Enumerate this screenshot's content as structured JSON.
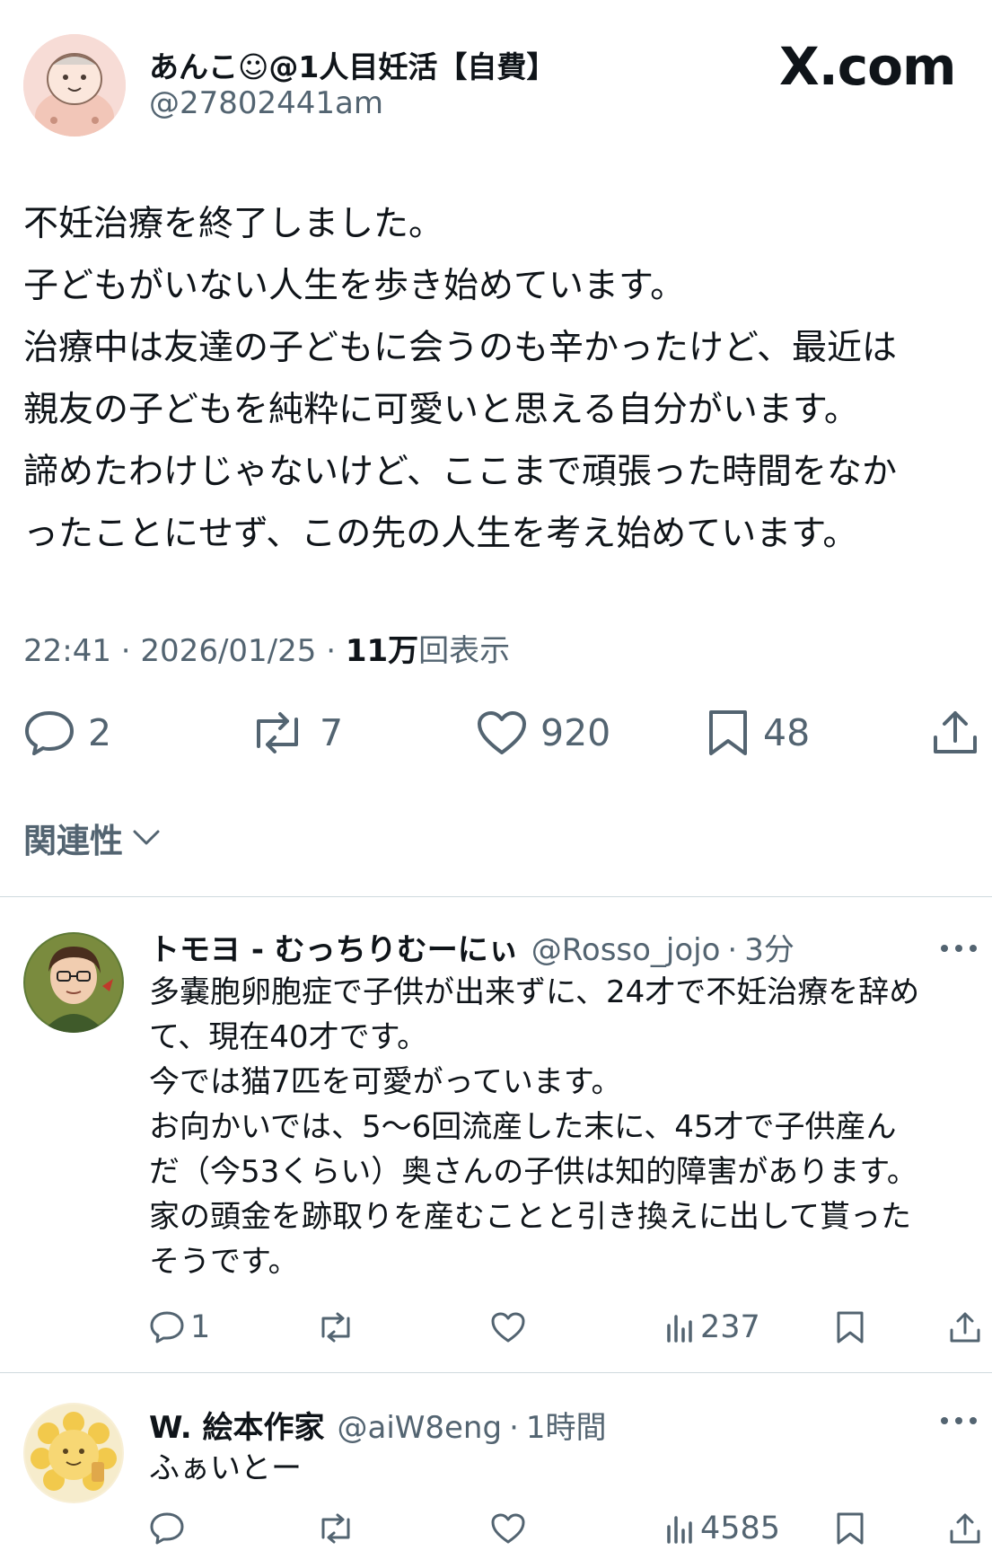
{
  "main_tweet": {
    "display_name": "あんこ☺@1人目妊活【自費】",
    "handle": "@27802441am",
    "site_logo": "X.com",
    "body_lines": [
      "不妊治療を終了しました。",
      "子どもがいない人生を歩き始めています。",
      "治療中は友達の子どもに会うのも辛かったけど、最近は",
      "親友の子どもを純粋に可愛いと思える自分がいます。",
      "諦めたわけじゃないけど、ここまで頑張った時間をなか",
      "ったことにせず、この先の人生を考え始めています。"
    ],
    "time": "22:41",
    "date": "2026/01/25",
    "views_count": "11万",
    "views_label": "回表示",
    "sep": "·",
    "actions": {
      "replies": "2",
      "reposts": "7",
      "likes": "920",
      "bookmarks": "48"
    }
  },
  "sort": {
    "label": "関連性",
    "icon": "chevron-down-icon"
  },
  "replies": [
    {
      "display_name": "トモヨ - むっちりむーにぃ",
      "handle": "@Rosso_jojo",
      "time": "3分",
      "body_lines": [
        "多嚢胞卵胞症で子供が出来ずに、24才で不妊治療を辞め",
        "て、現在40才です。",
        "今では猫7匹を可愛がっています。",
        "お向かいでは、5〜6回流産した末に、45才で子供産ん",
        "だ（今53くらい）奥さんの子供は知的障害があります。",
        "家の頭金を跡取りを産むことと引き換えに出して貰った",
        "そうです。"
      ],
      "actions": {
        "replies": "1",
        "views": "237"
      }
    },
    {
      "display_name": "W. 絵本作家",
      "handle": "@aiW8eng",
      "time": "1時間",
      "body_lines": [
        "ふぁいとー"
      ],
      "actions": {
        "replies": "",
        "views": "4585"
      }
    }
  ],
  "colors": {
    "text": "#0f1419",
    "secondary": "#536471",
    "divider": "#cfd9de"
  }
}
